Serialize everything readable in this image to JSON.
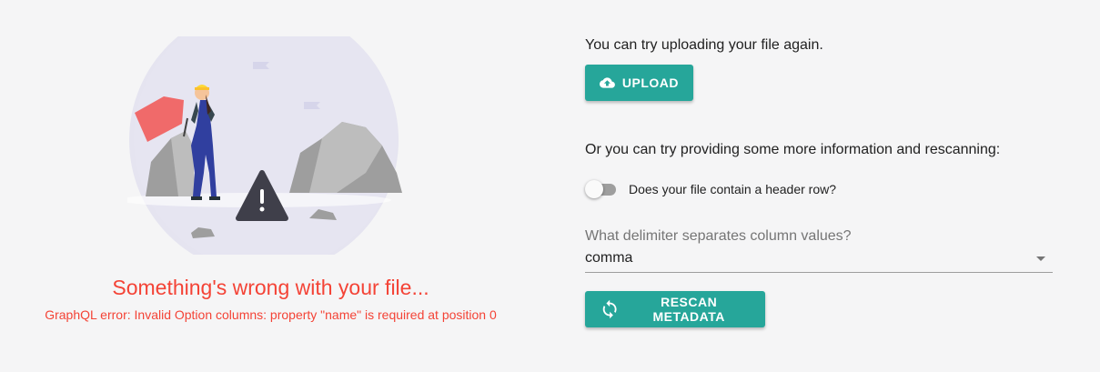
{
  "error": {
    "title": "Something's wrong with your file...",
    "detail": "GraphQL error: Invalid Option columns: property \"name\" is required at position 0"
  },
  "upload": {
    "prompt": "You can try uploading your file again.",
    "button_label": "UPLOAD"
  },
  "rescan": {
    "prompt": "Or you can try providing some more information and rescanning:",
    "header_toggle_label": "Does your file contain a header row?",
    "header_toggle_on": false,
    "delimiter_label": "What delimiter separates column values?",
    "delimiter_value": "comma",
    "button_label": "RESCAN METADATA"
  },
  "colors": {
    "accent": "#26a69a",
    "error": "#f44336"
  },
  "icons": {
    "upload": "cloud-upload-icon",
    "rescan": "refresh-icon",
    "warning": "warning-icon"
  }
}
